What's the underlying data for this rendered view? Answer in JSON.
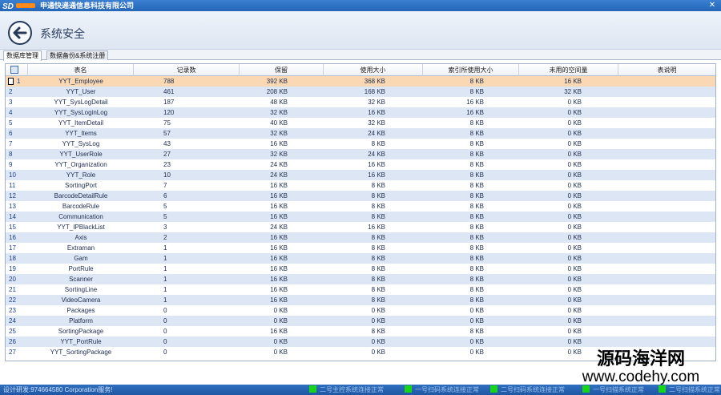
{
  "app": {
    "title": "申通快递通信息科技有限公司",
    "close": "✕"
  },
  "header": {
    "title": "系统安全"
  },
  "tabs": [
    {
      "label": "数据库管理",
      "active": true
    },
    {
      "label": "数据备份&系统注册",
      "active": false
    }
  ],
  "table": {
    "columns": [
      "表名",
      "记录数",
      "保留",
      "使用大小",
      "索引所使用大小",
      "未用的空间量",
      "表说明"
    ],
    "rows": [
      [
        "1",
        "YYT_Employee",
        "788",
        "392 KB",
        "368 KB",
        "8 KB",
        "16 KB",
        ""
      ],
      [
        "2",
        "YYT_User",
        "461",
        "208 KB",
        "168 KB",
        "8 KB",
        "32 KB",
        ""
      ],
      [
        "3",
        "YYT_SysLogDetail",
        "187",
        "48 KB",
        "32 KB",
        "16 KB",
        "0 KB",
        ""
      ],
      [
        "4",
        "YYT_SysLoginLog",
        "120",
        "32 KB",
        "16 KB",
        "16 KB",
        "0 KB",
        ""
      ],
      [
        "5",
        "YYT_ItemDetail",
        "75",
        "40 KB",
        "32 KB",
        "8 KB",
        "0 KB",
        ""
      ],
      [
        "6",
        "YYT_Items",
        "57",
        "32 KB",
        "24 KB",
        "8 KB",
        "0 KB",
        ""
      ],
      [
        "7",
        "YYT_SysLog",
        "43",
        "16 KB",
        "8 KB",
        "8 KB",
        "0 KB",
        ""
      ],
      [
        "8",
        "YYT_UserRole",
        "27",
        "32 KB",
        "24 KB",
        "8 KB",
        "0 KB",
        ""
      ],
      [
        "9",
        "YYT_Organization",
        "23",
        "24 KB",
        "16 KB",
        "8 KB",
        "0 KB",
        ""
      ],
      [
        "10",
        "YYT_Role",
        "10",
        "24 KB",
        "16 KB",
        "8 KB",
        "0 KB",
        ""
      ],
      [
        "11",
        "SortingPort",
        "7",
        "16 KB",
        "8 KB",
        "8 KB",
        "0 KB",
        ""
      ],
      [
        "12",
        "BarcodeDetailRule",
        "6",
        "16 KB",
        "8 KB",
        "8 KB",
        "0 KB",
        ""
      ],
      [
        "13",
        "BarcodeRule",
        "5",
        "16 KB",
        "8 KB",
        "8 KB",
        "0 KB",
        ""
      ],
      [
        "14",
        "Communication",
        "5",
        "16 KB",
        "8 KB",
        "8 KB",
        "0 KB",
        ""
      ],
      [
        "15",
        "YYT_IPBlackList",
        "3",
        "24 KB",
        "16 KB",
        "8 KB",
        "0 KB",
        ""
      ],
      [
        "16",
        "Axis",
        "2",
        "16 KB",
        "8 KB",
        "8 KB",
        "0 KB",
        ""
      ],
      [
        "17",
        "Extraman",
        "1",
        "16 KB",
        "8 KB",
        "8 KB",
        "0 KB",
        ""
      ],
      [
        "18",
        "Gam",
        "1",
        "16 KB",
        "8 KB",
        "8 KB",
        "0 KB",
        ""
      ],
      [
        "19",
        "PortRule",
        "1",
        "16 KB",
        "8 KB",
        "8 KB",
        "0 KB",
        ""
      ],
      [
        "20",
        "Scanner",
        "1",
        "16 KB",
        "8 KB",
        "8 KB",
        "0 KB",
        ""
      ],
      [
        "21",
        "SortingLine",
        "1",
        "16 KB",
        "8 KB",
        "8 KB",
        "0 KB",
        ""
      ],
      [
        "22",
        "VideoCamera",
        "1",
        "16 KB",
        "8 KB",
        "8 KB",
        "0 KB",
        ""
      ],
      [
        "23",
        "Packages",
        "0",
        "0 KB",
        "0 KB",
        "0 KB",
        "0 KB",
        ""
      ],
      [
        "24",
        "Platform",
        "0",
        "0 KB",
        "0 KB",
        "0 KB",
        "0 KB",
        ""
      ],
      [
        "25",
        "SortingPackage",
        "0",
        "16 KB",
        "8 KB",
        "8 KB",
        "0 KB",
        ""
      ],
      [
        "26",
        "YYT_PortRule",
        "0",
        "0 KB",
        "0 KB",
        "0 KB",
        "0 KB",
        ""
      ],
      [
        "27",
        "YYT_SortingPackage",
        "0",
        "0 KB",
        "0 KB",
        "0 KB",
        "0 KB",
        ""
      ]
    ],
    "selected_row": 0
  },
  "status": {
    "left": "设计研发:974664580 Corporation服务!",
    "items": [
      "二号主控系统连接正常",
      "一号扫码系统连接正常",
      "二号扫码系统连接正常",
      "一号扫描系统正常",
      "二号扫描系统正常"
    ],
    "indicator_color": "#19d419"
  },
  "watermark": {
    "line1": "源码海洋网",
    "line2": "www.codehy.com"
  }
}
